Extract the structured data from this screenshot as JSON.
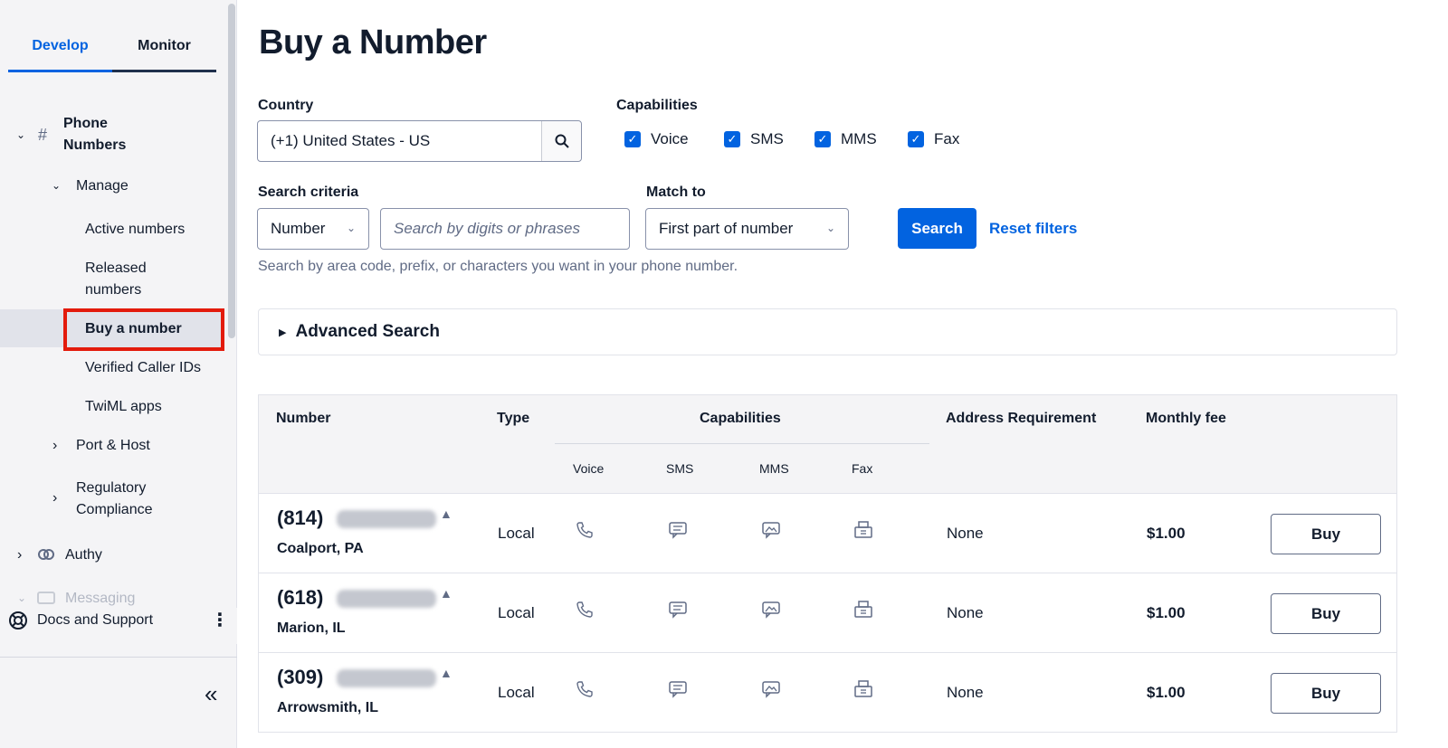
{
  "sidebar": {
    "tabs": [
      {
        "label": "Develop",
        "active": true
      },
      {
        "label": "Monitor",
        "active": false
      }
    ],
    "section": {
      "label_line1": "Phone",
      "label_line2": "Numbers"
    },
    "manage": "Manage",
    "items": {
      "active_numbers": "Active numbers",
      "released_line1": "Released",
      "released_line2": "numbers",
      "buy_number": "Buy a number",
      "verified_caller_ids": "Verified Caller IDs",
      "twiml_apps": "TwiML apps"
    },
    "port_host": "Port & Host",
    "regulatory_line1": "Regulatory",
    "regulatory_line2": "Compliance",
    "authy": "Authy",
    "messaging": "Messaging",
    "docs_support": "Docs and Support",
    "collapse_icon": "«"
  },
  "page": {
    "title": "Buy a Number"
  },
  "form": {
    "country_label": "Country",
    "country_value": "(+1) United States - US",
    "capabilities_label": "Capabilities",
    "capabilities": [
      {
        "label": "Voice",
        "checked": true
      },
      {
        "label": "SMS",
        "checked": true
      },
      {
        "label": "MMS",
        "checked": true
      },
      {
        "label": "Fax",
        "checked": true
      }
    ],
    "search_criteria_label": "Search criteria",
    "criteria_value": "Number",
    "search_placeholder": "Search by digits or phrases",
    "match_to_label": "Match to",
    "match_to_value": "First part of number",
    "search_button": "Search",
    "reset_link": "Reset filters",
    "helper_text": "Search by area code, prefix, or characters you want in your phone number.",
    "advanced_search": "Advanced Search"
  },
  "table": {
    "headers": {
      "number": "Number",
      "type": "Type",
      "capabilities": "Capabilities",
      "address_requirement": "Address Requirement",
      "monthly_fee": "Monthly fee",
      "voice": "Voice",
      "sms": "SMS",
      "mms": "MMS",
      "fax": "Fax"
    },
    "rows": [
      {
        "area_code": "(814)",
        "location": "Coalport, PA",
        "type": "Local",
        "address": "None",
        "fee": "$1.00",
        "action": "Buy"
      },
      {
        "area_code": "(618)",
        "location": "Marion, IL",
        "type": "Local",
        "address": "None",
        "fee": "$1.00",
        "action": "Buy"
      },
      {
        "area_code": "(309)",
        "location": "Arrowsmith, IL",
        "type": "Local",
        "address": "None",
        "fee": "$1.00",
        "action": "Buy"
      }
    ]
  },
  "icons": {
    "search": "search-icon",
    "voice": "phone-icon",
    "sms": "chat-icon",
    "mms": "image-message-icon",
    "fax": "fax-icon"
  },
  "colors": {
    "accent": "#0263e0",
    "highlight": "#e31b0c"
  }
}
